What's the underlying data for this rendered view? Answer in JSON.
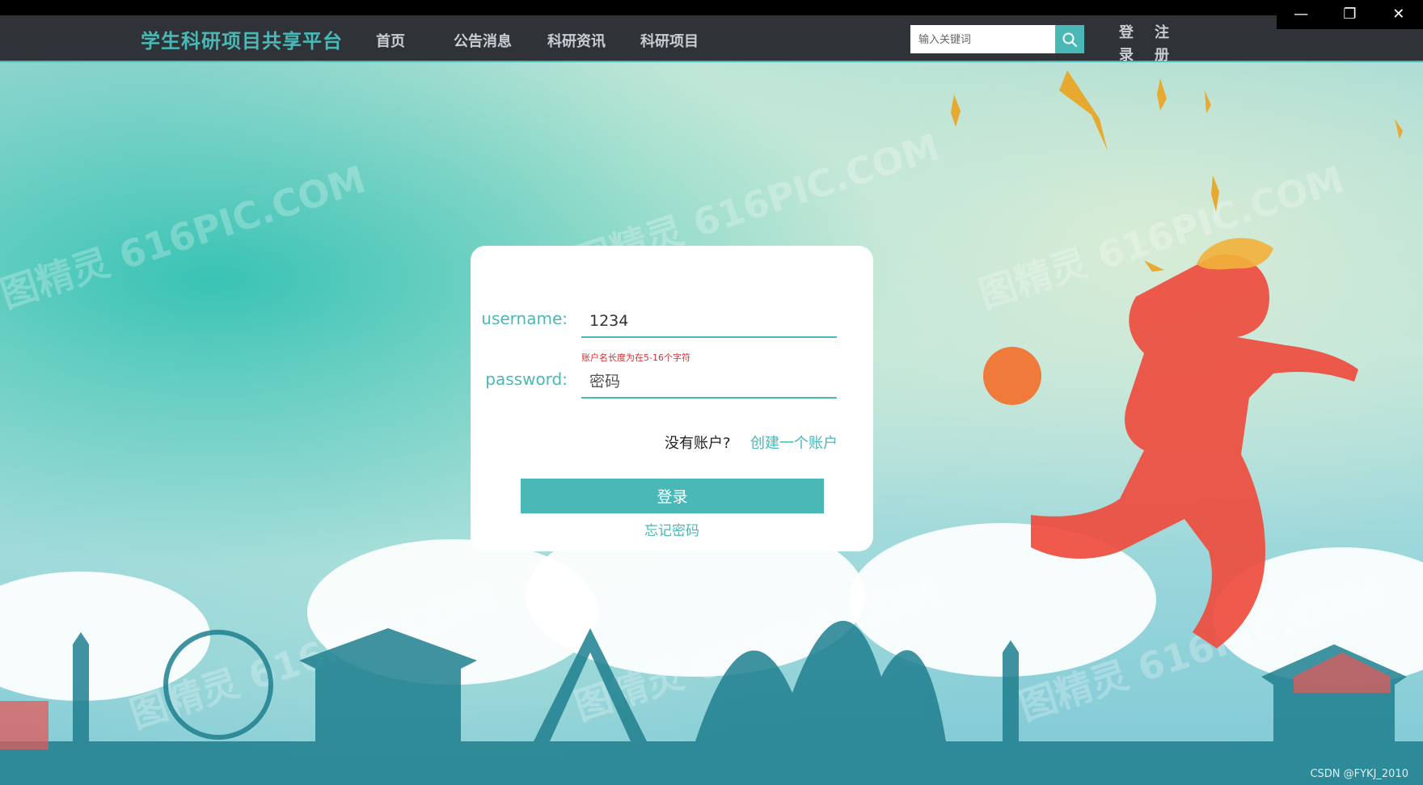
{
  "window": {
    "minimize_glyph": "—",
    "restore_glyph": "❐",
    "close_glyph": "✕"
  },
  "header": {
    "brand": "学生科研项目共享平台",
    "nav": [
      "首页",
      "公告消息",
      "科研资讯",
      "科研项目"
    ],
    "search": {
      "placeholder": "输入关键词",
      "icon": "search-icon"
    },
    "login": "登录",
    "register": "注册"
  },
  "login_form": {
    "username_label": "username:",
    "username_value": "1234",
    "username_error": "账户名长度为在5-16个字符",
    "password_label": "password:",
    "password_placeholder": "密码",
    "no_account_text": "没有账户?",
    "create_account_link": "创建一个账户",
    "submit_label": "登录",
    "forgot_password_link": "忘记密码"
  },
  "background": {
    "watermark": "图精灵 616PIC.COM"
  },
  "footer": {
    "credit": "CSDN @FYKJ_2010"
  },
  "colors": {
    "accent": "#49b8b6",
    "navbar": "#2f3338",
    "error": "#d6302f"
  }
}
